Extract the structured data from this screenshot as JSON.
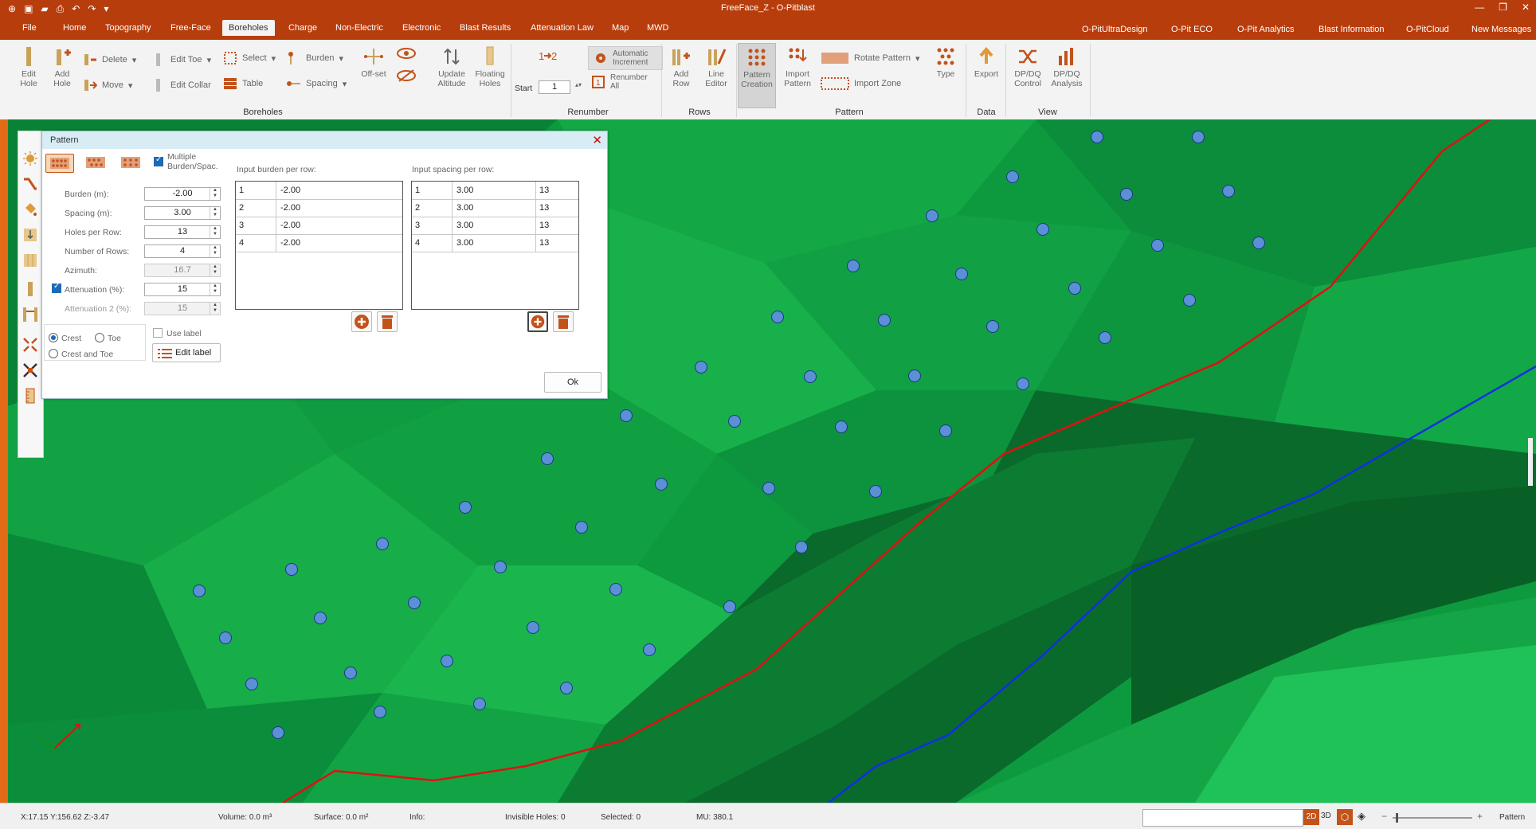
{
  "app": {
    "title": "FreeFace_Z - O-Pitblast"
  },
  "menu": {
    "tabs": [
      "File",
      "Home",
      "Topography",
      "Free-Face",
      "Boreholes",
      "Charge",
      "Non-Electric",
      "Electronic",
      "Blast Results",
      "Attenuation Law",
      "Map",
      "MWD"
    ],
    "active_tab": "Boreholes",
    "right_links": [
      "O-PitUltraDesign",
      "O-Pit ECO",
      "O-Pit Analytics",
      "Blast Information",
      "O-PitCloud",
      "New Messages"
    ]
  },
  "ribbon": {
    "boreholes": {
      "edit_hole": "Edit Hole",
      "add_hole": "Add Hole",
      "delete": "Delete",
      "move": "Move",
      "edit_toe": "Edit Toe",
      "edit_collar": "Edit Collar",
      "select": "Select",
      "table": "Table",
      "burden": "Burden",
      "spacing": "Spacing",
      "offset": "Off-set",
      "update_altitude": "Update Altitude",
      "floating_holes": "Floating Holes",
      "group": "Boreholes"
    },
    "renumber": {
      "automatic_increment": "Automatic Increment",
      "renumber_all": "Renumber All",
      "start_label": "Start",
      "start_value": "1",
      "group": "Renumber"
    },
    "rows": {
      "add_row": "Add Row",
      "line_editor": "Line Editor",
      "group": "Rows"
    },
    "pattern": {
      "pattern_creation": "Pattern Creation",
      "import_pattern": "Import Pattern",
      "rotate_pattern": "Rotate Pattern",
      "import_zone": "Import Zone",
      "type": "Type",
      "group": "Pattern"
    },
    "data": {
      "export": "Export",
      "group": "Data"
    },
    "view": {
      "dpdq_control": "DP/DQ Control",
      "dpdq_analysis": "DP/DQ Analysis",
      "group": "View"
    }
  },
  "dialog": {
    "title": "Pattern",
    "multiple_label": "Multiple Burden/Spac.",
    "multiple_checked": true,
    "fields": {
      "burden_label": "Burden (m):",
      "burden": "-2.00",
      "spacing_label": "Spacing (m):",
      "spacing": "3.00",
      "holes_label": "Holes per Row:",
      "holes": "13",
      "rows_label": "Number of Rows:",
      "rows": "4",
      "azimuth_label": "Azimuth:",
      "azimuth": "16.7",
      "attenuation_label": "Attenuation (%):",
      "attenuation": "15",
      "attenuation_checked": true,
      "attenuation2_label": "Attenuation 2 (%):",
      "attenuation2": "15"
    },
    "position": {
      "crest": "Crest",
      "toe": "Toe",
      "crest_and_toe": "Crest and Toe",
      "selected": "crest"
    },
    "use_label": "Use label",
    "edit_label": "Edit label",
    "burden_table_title": "Input burden per row:",
    "burden_rows": [
      [
        "1",
        "-2.00"
      ],
      [
        "2",
        "-2.00"
      ],
      [
        "3",
        "-2.00"
      ],
      [
        "4",
        "-2.00"
      ]
    ],
    "spacing_table_title": "Input spacing per row:",
    "spacing_rows": [
      [
        "1",
        "3.00",
        "13"
      ],
      [
        "2",
        "3.00",
        "13"
      ],
      [
        "3",
        "3.00",
        "13"
      ],
      [
        "4",
        "3.00",
        "13"
      ]
    ],
    "ok": "Ok"
  },
  "status": {
    "coords": "X:17.15   Y:156.62   Z:-3.47",
    "volume": "Volume: 0.0 m³",
    "surface": "Surface: 0.0 m²",
    "info": "Info:",
    "invisible": "Invisible Holes: 0",
    "selected": "Selected: 0",
    "mu": "MU: 380.1",
    "mode_2d": "2D",
    "mode_3d": "3D",
    "pattern": "Pattern"
  },
  "colors": {
    "titlebar": "#b83d0c",
    "terrain": "#0a8a3a",
    "hole": "#5b8fd6",
    "red_line": "#e01010",
    "blue_line": "#1030e0",
    "accent_orange": "#c2531b"
  }
}
